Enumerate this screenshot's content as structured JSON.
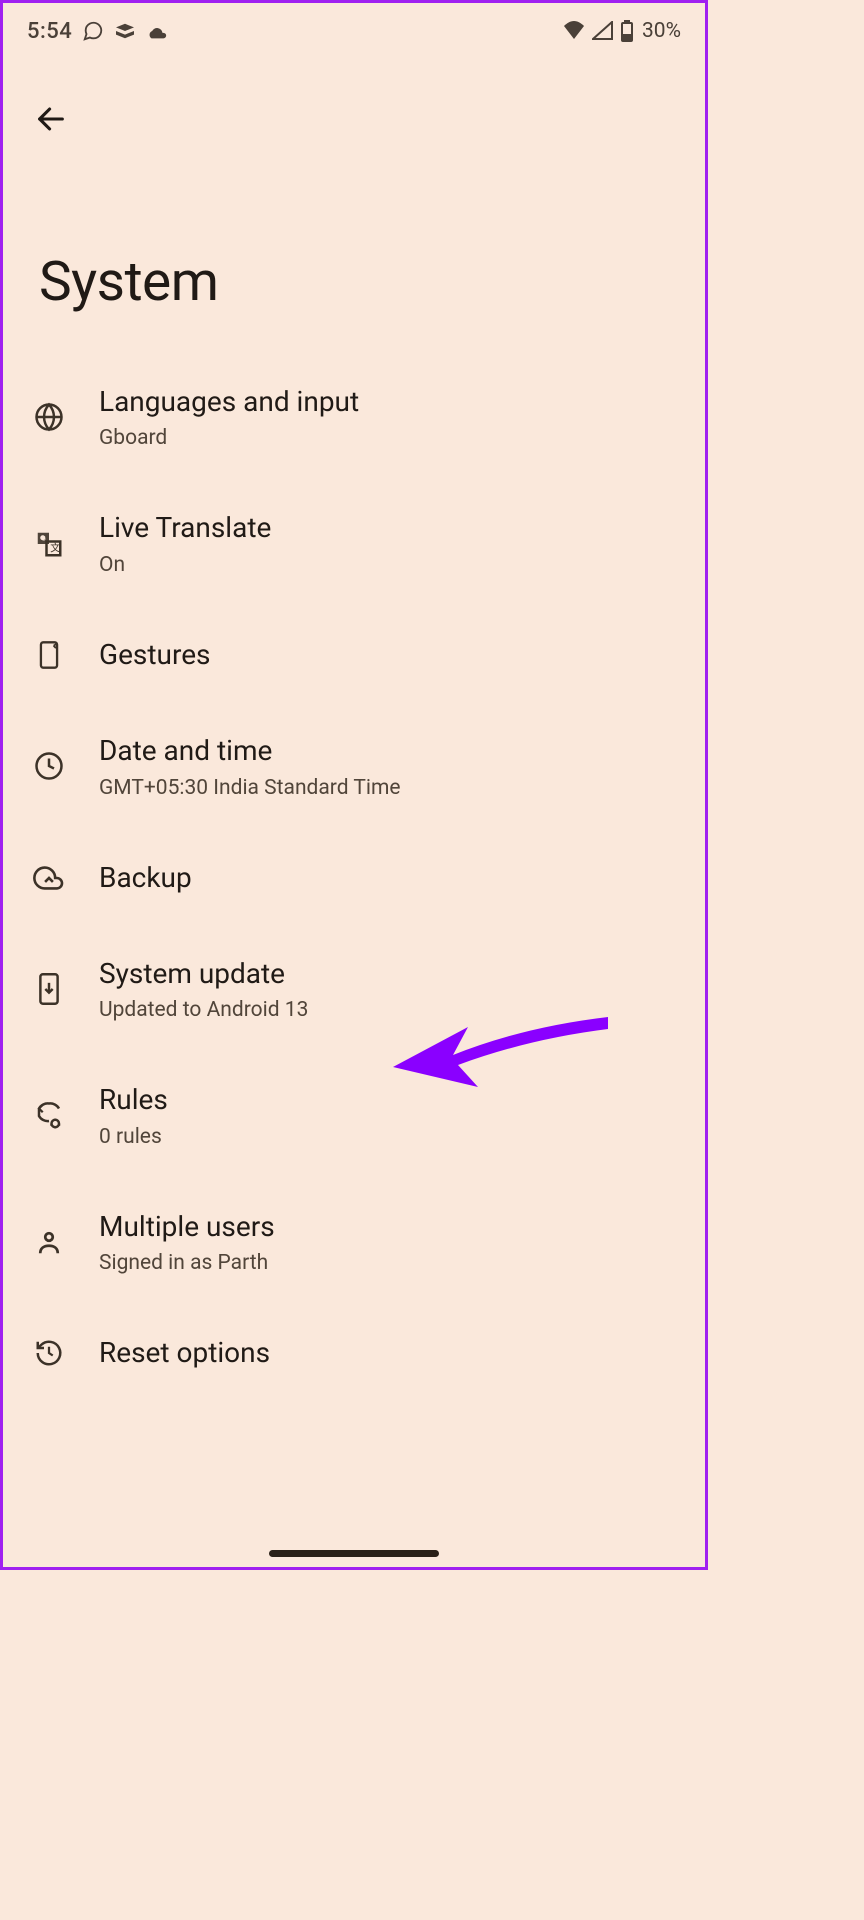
{
  "status": {
    "time": "5:54",
    "battery": "30%"
  },
  "page": {
    "title": "System"
  },
  "items": [
    {
      "title": "Languages and input",
      "sub": "Gboard",
      "icon": "globe"
    },
    {
      "title": "Live Translate",
      "sub": "On",
      "icon": "translate"
    },
    {
      "title": "Gestures",
      "sub": "",
      "icon": "gestures"
    },
    {
      "title": "Date and time",
      "sub": "GMT+05:30 India Standard Time",
      "icon": "clock"
    },
    {
      "title": "Backup",
      "sub": "",
      "icon": "cloud-up"
    },
    {
      "title": "System update",
      "sub": "Updated to Android 13",
      "icon": "phone-down"
    },
    {
      "title": "Rules",
      "sub": "0 rules",
      "icon": "rules"
    },
    {
      "title": "Multiple users",
      "sub": "Signed in as Parth",
      "icon": "person"
    },
    {
      "title": "Reset options",
      "sub": "",
      "icon": "reset"
    }
  ]
}
